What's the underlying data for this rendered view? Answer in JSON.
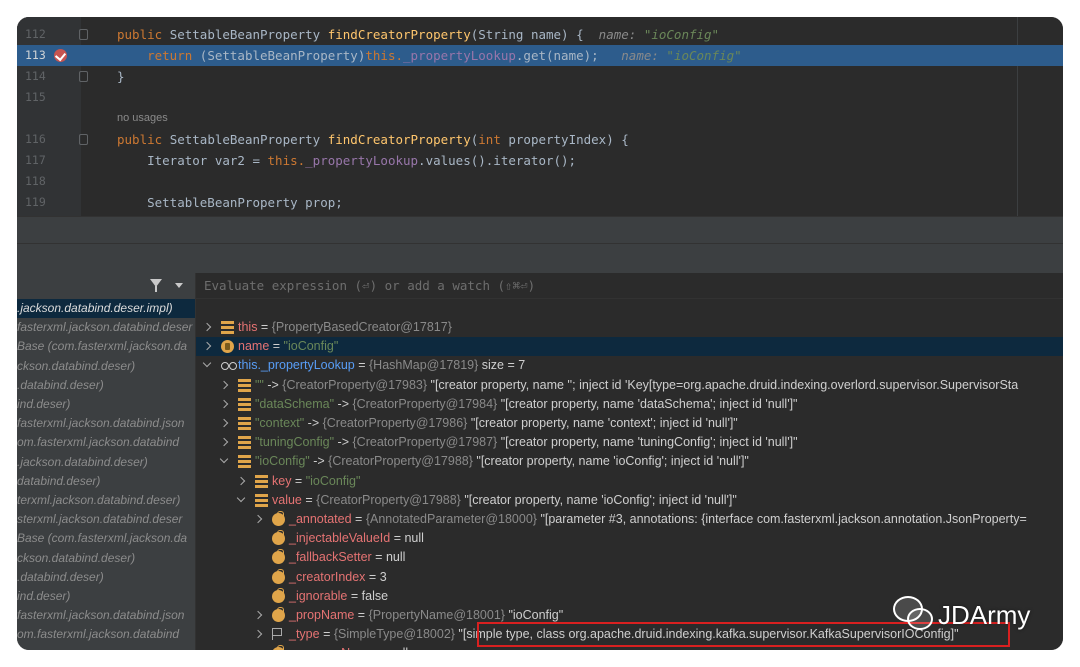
{
  "editor": {
    "lines": [
      {
        "num": "112",
        "parts": [
          {
            "t": "public ",
            "c": "kw"
          },
          {
            "t": "SettableBeanProperty ",
            "c": ""
          },
          {
            "t": "findCreatorProperty",
            "c": "fn"
          },
          {
            "t": "(String name) {  ",
            "c": ""
          },
          {
            "t": "name: ",
            "c": "hint"
          },
          {
            "t": "\"ioConfig\"",
            "c": "hintval"
          }
        ]
      },
      {
        "num": "113",
        "parts": [
          {
            "t": "    return ",
            "c": "kw"
          },
          {
            "t": "(SettableBeanProperty)",
            "c": ""
          },
          {
            "t": "this.",
            "c": "kw"
          },
          {
            "t": "_propertyLookup",
            "c": "fld"
          },
          {
            "t": ".get(name);   ",
            "c": ""
          },
          {
            "t": "name: ",
            "c": "hint"
          },
          {
            "t": "\"ioConfig\"",
            "c": "hintval"
          }
        ]
      },
      {
        "num": "114",
        "parts": [
          {
            "t": "}",
            "c": ""
          }
        ]
      },
      {
        "num": "115",
        "parts": []
      },
      {
        "num": "116",
        "parts": [
          {
            "t": "public ",
            "c": "kw"
          },
          {
            "t": "SettableBeanProperty ",
            "c": ""
          },
          {
            "t": "findCreatorProperty",
            "c": "fn"
          },
          {
            "t": "(",
            "c": ""
          },
          {
            "t": "int ",
            "c": "kw"
          },
          {
            "t": "propertyIndex) {",
            "c": ""
          }
        ]
      },
      {
        "num": "117",
        "parts": [
          {
            "t": "    Iterator var2 = ",
            "c": ""
          },
          {
            "t": "this.",
            "c": "kw"
          },
          {
            "t": "_propertyLookup",
            "c": "fld"
          },
          {
            "t": ".values().iterator();",
            "c": ""
          }
        ]
      },
      {
        "num": "118",
        "parts": []
      },
      {
        "num": "119",
        "parts": [
          {
            "t": "    SettableBeanProperty prop;",
            "c": ""
          }
        ]
      }
    ],
    "no_usages": "no usages"
  },
  "debugger": {
    "eval_placeholder": "Evaluate expression (⏎) or add a watch (⇧⌘⏎)",
    "frames": [
      ".jackson.databind.deser.impl)",
      "fasterxml.jackson.databind.deser",
      "Base (com.fasterxml.jackson.da",
      "ckson.databind.deser)",
      ".databind.deser)",
      "ind.deser)",
      "fasterxml.jackson.databind.json",
      "om.fasterxml.jackson.databind",
      ".jackson.databind.deser)",
      "databind.deser)",
      "terxml.jackson.databind.deser)",
      "sterxml.jackson.databind.deser",
      "Base (com.fasterxml.jackson.da",
      "ckson.databind.deser)",
      ".databind.deser)",
      "ind.deser)",
      "fasterxml.jackson.databind.json",
      "om.fasterxml.jackson.databind"
    ],
    "variables": [
      {
        "name": "this",
        "sep": " = ",
        "type": "{PropertyBasedCreator@17817}",
        "val": ""
      },
      {
        "name": "name",
        "sep": " = ",
        "type": "",
        "val": "\"ioConfig\""
      },
      {
        "name": "this._propertyLookup",
        "sep": " = ",
        "type": "{HashMap@17819}",
        "val": "  size = 7"
      },
      {
        "name": "\"\"",
        "sep": " -> ",
        "type": "{CreatorProperty@17983}",
        "val": " \"[creator property, name ''; inject id 'Key[type=org.apache.druid.indexing.overlord.supervisor.SupervisorSta"
      },
      {
        "name": "\"dataSchema\"",
        "sep": " -> ",
        "type": "{CreatorProperty@17984}",
        "val": " \"[creator property, name 'dataSchema'; inject id 'null']\""
      },
      {
        "name": "\"context\"",
        "sep": " -> ",
        "type": "{CreatorProperty@17986}",
        "val": " \"[creator property, name 'context'; inject id 'null']\""
      },
      {
        "name": "\"tuningConfig\"",
        "sep": " -> ",
        "type": "{CreatorProperty@17987}",
        "val": " \"[creator property, name 'tuningConfig'; inject id 'null']\""
      },
      {
        "name": "\"ioConfig\"",
        "sep": " -> ",
        "type": "{CreatorProperty@17988}",
        "val": " \"[creator property, name 'ioConfig'; inject id 'null']\""
      },
      {
        "name": "key",
        "sep": " = ",
        "type": "",
        "val": "\"ioConfig\""
      },
      {
        "name": "value",
        "sep": " = ",
        "type": "{CreatorProperty@17988}",
        "val": " \"[creator property, name 'ioConfig'; inject id 'null']\""
      },
      {
        "name": "_annotated",
        "sep": " = ",
        "type": "{AnnotatedParameter@18000}",
        "val": " \"[parameter #3, annotations: {interface com.fasterxml.jackson.annotation.JsonProperty="
      },
      {
        "name": "_injectableValueId",
        "sep": " = ",
        "type": "",
        "val": "null"
      },
      {
        "name": "_fallbackSetter",
        "sep": " = ",
        "type": "",
        "val": "null"
      },
      {
        "name": "_creatorIndex",
        "sep": " = ",
        "type": "",
        "val": "3"
      },
      {
        "name": "_ignorable",
        "sep": " = ",
        "type": "",
        "val": "false"
      },
      {
        "name": "_propName",
        "sep": " = ",
        "type": "{PropertyName@18001}",
        "val": " \"ioConfig\""
      },
      {
        "name": "_type",
        "sep": " = ",
        "type": "{SimpleType@18002}",
        "val": " \"[simple type, class org.apache.druid.indexing.kafka.supervisor.KafkaSupervisorIOConfig]\""
      },
      {
        "name": "_wrapperName",
        "sep": " = ",
        "type": "",
        "val": "null"
      }
    ]
  },
  "watermark": {
    "text": "JDArmy"
  },
  "colors": {
    "highlight": "#2d5c8c",
    "selection": "#0d293e",
    "annotation_box": "#d92020"
  }
}
